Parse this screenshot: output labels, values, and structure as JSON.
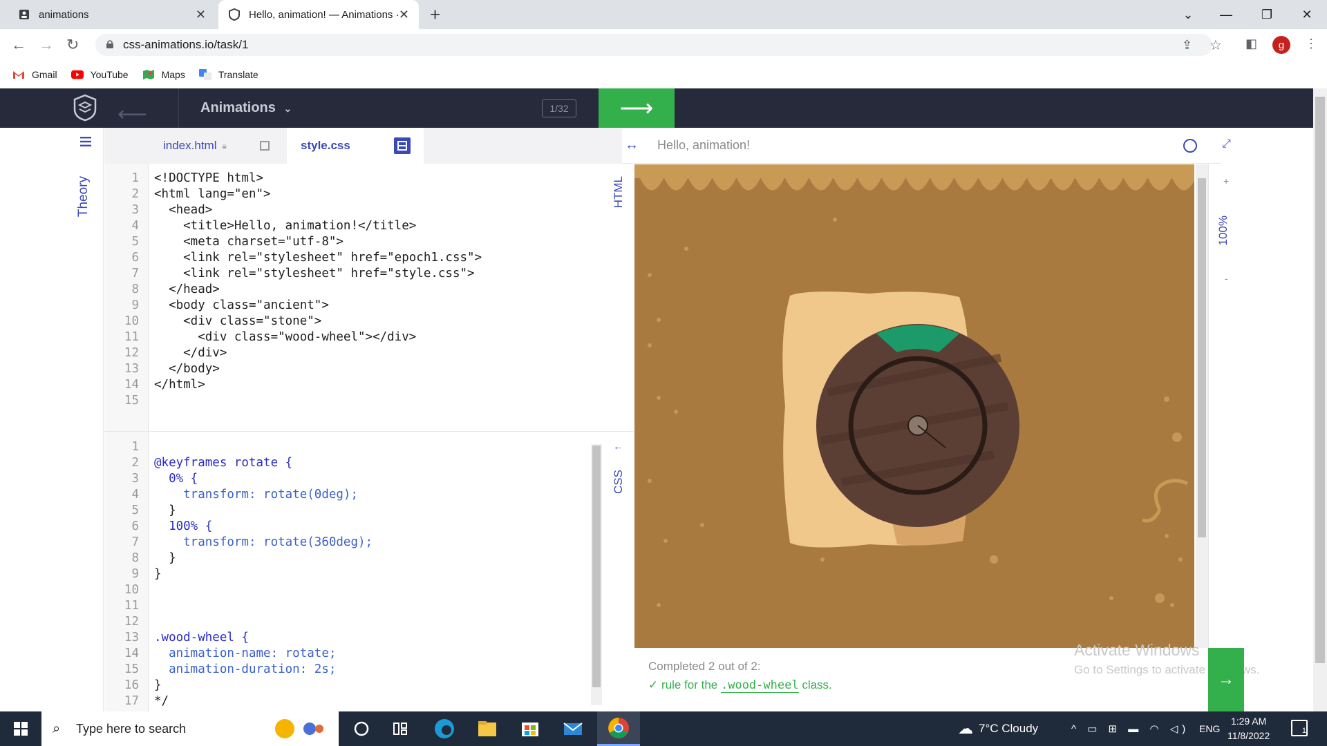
{
  "browser": {
    "tabs": [
      {
        "title": "animations"
      },
      {
        "title": "Hello, animation! — Animations ·"
      }
    ],
    "url": "css-animations.io/task/1",
    "bookmarks": [
      "Gmail",
      "YouTube",
      "Maps",
      "Translate"
    ],
    "profile_initial": "g"
  },
  "app": {
    "title": "Animations",
    "counter": "1/32",
    "theory_label": "Theory",
    "file_tabs": [
      "index.html",
      "style.css"
    ],
    "html_label": "HTML",
    "css_label": "CSS",
    "preview_title": "Hello, animation!",
    "zoom": "100%",
    "zoom_plus": "+",
    "zoom_minus": "-"
  },
  "html_code": [
    {
      "n": "1",
      "text": "<!DOCTYPE html>"
    },
    {
      "n": "2",
      "text": "<html lang=\"en\">"
    },
    {
      "n": "3",
      "text": "  <head>"
    },
    {
      "n": "4",
      "text": "    <title>Hello, animation!</title>"
    },
    {
      "n": "5",
      "text": "    <meta charset=\"utf-8\">"
    },
    {
      "n": "6",
      "text": "    <link rel=\"stylesheet\" href=\"epoch1.css\">"
    },
    {
      "n": "7",
      "text": "    <link rel=\"stylesheet\" href=\"style.css\">"
    },
    {
      "n": "8",
      "text": "  </head>"
    },
    {
      "n": "9",
      "text": "  <body class=\"ancient\">"
    },
    {
      "n": "10",
      "text": "    <div class=\"stone\">"
    },
    {
      "n": "11",
      "text": "      <div class=\"wood-wheel\"></div>"
    },
    {
      "n": "12",
      "text": "    </div>"
    },
    {
      "n": "13",
      "text": "  </body>"
    },
    {
      "n": "14",
      "text": "</html>"
    },
    {
      "n": "15",
      "text": ""
    }
  ],
  "css_code": [
    {
      "n": "1",
      "text": ""
    },
    {
      "n": "2",
      "text": "@keyframes rotate {"
    },
    {
      "n": "3",
      "text": "  0% {"
    },
    {
      "n": "4",
      "text": "    transform: rotate(0deg);"
    },
    {
      "n": "5",
      "text": "  }"
    },
    {
      "n": "6",
      "text": "  100% {"
    },
    {
      "n": "7",
      "text": "    transform: rotate(360deg);"
    },
    {
      "n": "8",
      "text": "  }"
    },
    {
      "n": "9",
      "text": "}"
    },
    {
      "n": "10",
      "text": ""
    },
    {
      "n": "11",
      "text": ""
    },
    {
      "n": "12",
      "text": ""
    },
    {
      "n": "13",
      "text": ".wood-wheel {"
    },
    {
      "n": "14",
      "text": "  animation-name: rotate;"
    },
    {
      "n": "15",
      "text": "  animation-duration: 2s;"
    },
    {
      "n": "16",
      "text": "}"
    },
    {
      "n": "17",
      "text": "*/"
    }
  ],
  "status": {
    "title": "Completed 2 out of 2:",
    "rule_prefix": "rule for the",
    "rule_class": ".wood-wheel",
    "rule_suffix": "class."
  },
  "watermark": {
    "line1": "Activate Windows",
    "line2": "Go to Settings to activate Windows."
  },
  "taskbar": {
    "search_placeholder": "Type here to search",
    "weather": "7°C  Cloudy",
    "lang": "ENG",
    "time": "1:29 AM",
    "date": "11/8/2022",
    "notif_count": "1"
  },
  "colors": {
    "accent": "#3a49b8",
    "green": "#33b04c",
    "header": "#262a3a",
    "preview_bg": "#a97a3f"
  }
}
